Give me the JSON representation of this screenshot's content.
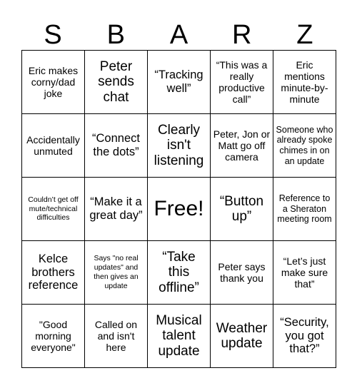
{
  "card": {
    "headers": [
      "S",
      "B",
      "A",
      "R",
      "Z"
    ],
    "rows": [
      [
        {
          "text": "Eric makes corny/dad joke",
          "size": "fs-m"
        },
        {
          "text": "Peter sends chat",
          "size": "fs-xl"
        },
        {
          "text": "“Tracking well”",
          "size": "fs-l"
        },
        {
          "text": "“This was a really productive call”",
          "size": "fs-m"
        },
        {
          "text": "Eric mentions minute-by-minute",
          "size": "fs-m"
        }
      ],
      [
        {
          "text": "Accidentally unmuted",
          "size": "fs-m"
        },
        {
          "text": "“Connect the dots”",
          "size": "fs-l"
        },
        {
          "text": "Clearly isn't listening",
          "size": "fs-xl"
        },
        {
          "text": "Peter, Jon or Matt go off camera",
          "size": "fs-m"
        },
        {
          "text": "Someone who already spoke chimes in on an update",
          "size": "fs-s"
        }
      ],
      [
        {
          "text": "Couldn’t get off mute/technical difficulties",
          "size": "fs-xs"
        },
        {
          "text": "“Make it a great day”",
          "size": "fs-l"
        },
        {
          "text": "Free!",
          "size": "fs-free"
        },
        {
          "text": "“Button up”",
          "size": "fs-xl"
        },
        {
          "text": "Reference to a Sheraton meeting room",
          "size": "fs-s"
        }
      ],
      [
        {
          "text": "Kelce brothers reference",
          "size": "fs-l"
        },
        {
          "text": "Says \"no real updates\" and then gives an update",
          "size": "fs-xs"
        },
        {
          "text": "“Take this offline”",
          "size": "fs-xl"
        },
        {
          "text": "Peter says thank you",
          "size": "fs-m"
        },
        {
          "text": "“Let’s just make sure that”",
          "size": "fs-m"
        }
      ],
      [
        {
          "text": "\"Good morning everyone\"",
          "size": "fs-m"
        },
        {
          "text": "Called on and isn't here",
          "size": "fs-m"
        },
        {
          "text": "Musical talent update",
          "size": "fs-xl"
        },
        {
          "text": "Weather update",
          "size": "fs-xl"
        },
        {
          "text": "“Security, you got that?”",
          "size": "fs-l"
        }
      ]
    ]
  }
}
